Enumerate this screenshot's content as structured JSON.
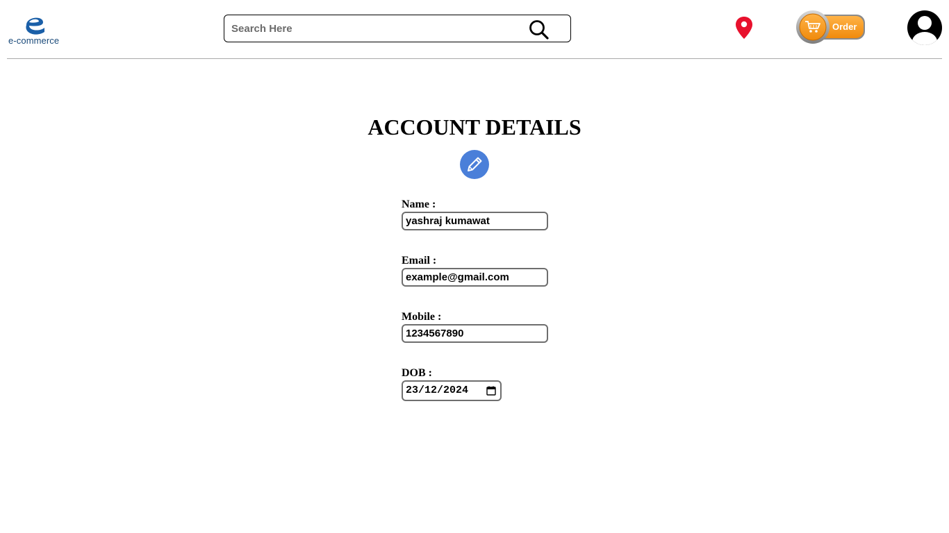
{
  "header": {
    "logo": {
      "icon": "e-logo-icon",
      "text": "e-commerce"
    },
    "search": {
      "placeholder": "Search Here",
      "value": "",
      "icon": "search-icon"
    },
    "location_icon": "location-pin-icon",
    "order_button": {
      "label": "Order",
      "icon": "shopping-cart-icon",
      "color": "#f7941d"
    },
    "avatar_icon": "user-avatar-icon"
  },
  "main": {
    "title": "ACCOUNT DETAILS",
    "edit_icon": "pencil-icon",
    "edit_color": "#4a7fd9",
    "fields": [
      {
        "label": "Name :",
        "value": "yashraj kumawat"
      },
      {
        "label": "Email :",
        "value": "example@gmail.com"
      },
      {
        "label": "Mobile :",
        "value": "1234567890"
      },
      {
        "label": "DOB :",
        "value": "23/12/2024",
        "icon": "calendar-icon"
      }
    ]
  }
}
